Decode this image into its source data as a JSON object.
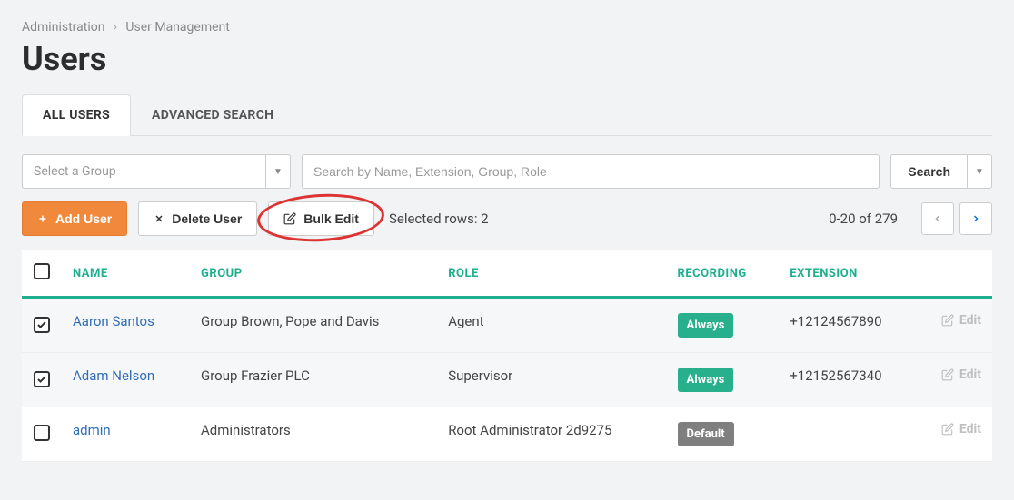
{
  "breadcrumb": {
    "item1": "Administration",
    "item2": "User Management"
  },
  "page_title": "Users",
  "tabs": {
    "all_users": "ALL USERS",
    "advanced": "ADVANCED SEARCH"
  },
  "filters": {
    "group_placeholder": "Select a Group",
    "search_placeholder": "Search by Name, Extension, Group, Role",
    "search_button": "Search"
  },
  "actions": {
    "add_user": "Add User",
    "delete_user": "Delete User",
    "bulk_edit": "Bulk Edit",
    "selected_rows_label": "Selected rows: 2",
    "range_label": "0-20 of 279"
  },
  "table": {
    "headers": {
      "name": "NAME",
      "group": "GROUP",
      "role": "ROLE",
      "recording": "RECORDING",
      "extension": "EXTENSION"
    },
    "edit_label": "Edit",
    "rows": [
      {
        "checked": true,
        "name": "Aaron Santos",
        "group": "Group Brown, Pope and Davis",
        "role": "Agent",
        "recording": "Always",
        "recording_type": "always",
        "extension": "+12124567890"
      },
      {
        "checked": true,
        "name": "Adam Nelson",
        "group": "Group Frazier PLC",
        "role": "Supervisor",
        "recording": "Always",
        "recording_type": "always",
        "extension": "+12152567340"
      },
      {
        "checked": false,
        "name": "admin",
        "group": "Administrators",
        "role": "Root Administrator 2d9275",
        "recording": "Default",
        "recording_type": "default",
        "extension": ""
      }
    ]
  }
}
